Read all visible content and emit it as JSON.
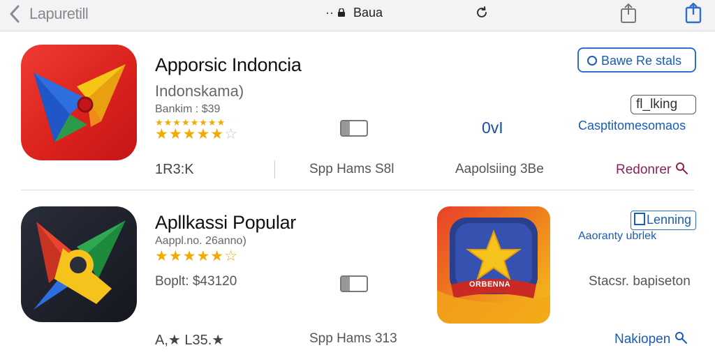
{
  "toolbar": {
    "back_label": "Lapuretill",
    "address_dots": "··",
    "address_text": "Baua"
  },
  "apps": [
    {
      "name": "Apporsic Indoncia",
      "subtitle": "Indonskama)",
      "rank": "Bankim : $39",
      "rating": 4.5,
      "stars_filled": "★★★★★",
      "stars_empty": "☆",
      "size": "1R3:K",
      "category": "Spp Hams S8l",
      "center_label": "0vI",
      "developer_note": "Aapolsiing 3Be",
      "primary_button": "Bawe Re stals",
      "secondary_button": "fl_lking",
      "secondary_caption": "Casptitomesomaos",
      "action_link": "Redonrer"
    },
    {
      "name": "Apllkassi Popular",
      "subtitle": "Aappl.no. 26anno)",
      "rating": 4.5,
      "stars_filled": "★★★★★",
      "stars_half": "☆",
      "price": "Boplt: $43120",
      "reviews": "A,★  L35.★",
      "category": "Spp Hams 313",
      "badge_text": "ORBENNA",
      "secondary_button": "Lenning",
      "secondary_caption": "Aaoranty ubrlek",
      "side_note": "Stacsr. bapiseton",
      "action_link": "Nakiopen"
    }
  ],
  "colors": {
    "accent_blue": "#1a5bb8",
    "star": "#f2a900",
    "link_red": "#8c1f5a"
  }
}
